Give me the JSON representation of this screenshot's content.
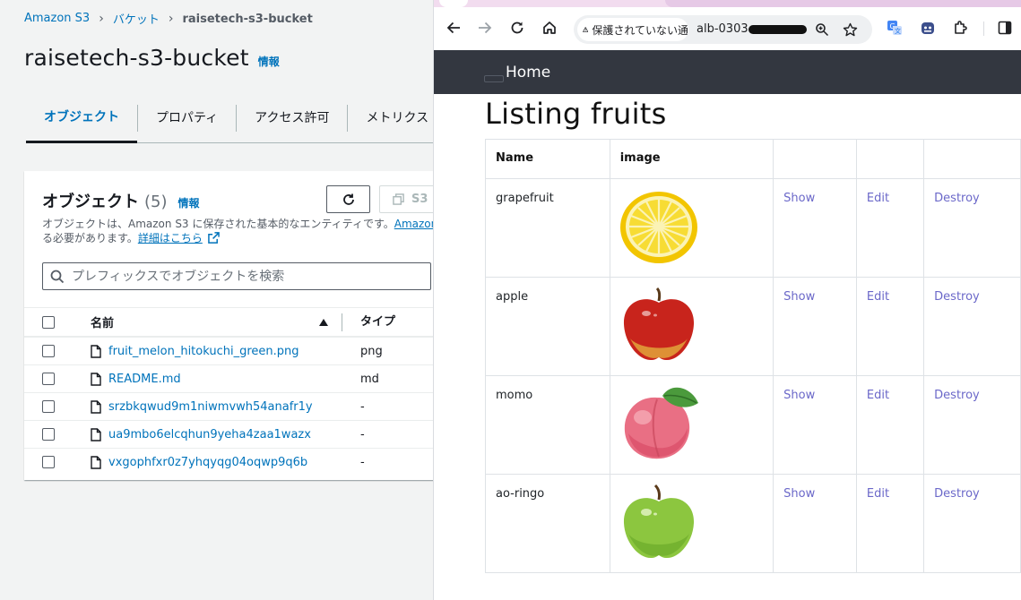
{
  "s3": {
    "breadcrumbs": [
      "Amazon S3",
      "バケット",
      "raisetech-s3-bucket"
    ],
    "title": "raisetech-s3-bucket",
    "info_link": "情報",
    "tabs": [
      "オブジェクト",
      "プロパティ",
      "アクセス許可",
      "メトリクス"
    ],
    "objects_panel": {
      "heading": "オブジェクト",
      "count": "(5)",
      "info_link": "情報",
      "copy_button": "S3",
      "description_line1": "オブジェクトは、Amazon S3 に保存された基本的なエンティティです。",
      "description_link1": "Amazon",
      "description_line2": "る必要があります。",
      "description_link2": "詳細はこちら",
      "search_placeholder": "プレフィックスでオブジェクトを検索",
      "columns": {
        "name": "名前",
        "type": "タイプ"
      },
      "rows": [
        {
          "name": "fruit_melon_hitokuchi_green.png",
          "type": "png"
        },
        {
          "name": "README.md",
          "type": "md"
        },
        {
          "name": "srzbkqwud9m1niwmvwh54anafr1y",
          "type": "-"
        },
        {
          "name": "ua9mbo6elcqhun9yeha4zaa1wazx",
          "type": "-"
        },
        {
          "name": "vxgophfxr0z7yhqyqg04oqwp9q6b",
          "type": "-"
        }
      ]
    }
  },
  "browser": {
    "security_chip": "保護されていない通",
    "url_prefix": "alb-0303-",
    "nav_home": "Home",
    "page_title": "Listing fruits",
    "table": {
      "headers": {
        "name": "Name",
        "image": "image"
      },
      "rows": [
        {
          "name": "grapefruit",
          "image": "grapefruit-image",
          "show": "Show",
          "edit": "Edit",
          "destroy": "Destroy"
        },
        {
          "name": "apple",
          "image": "apple-image",
          "show": "Show",
          "edit": "Edit",
          "destroy": "Destroy"
        },
        {
          "name": "momo",
          "image": "peach-image",
          "show": "Show",
          "edit": "Edit",
          "destroy": "Destroy"
        },
        {
          "name": "ao-ringo",
          "image": "green-apple-image",
          "show": "Show",
          "edit": "Edit",
          "destroy": "Destroy"
        }
      ]
    }
  },
  "colors": {
    "aws_link": "#0073bb",
    "navbar": "#333740",
    "fruit_link": "#6b68c9",
    "tabstrip": "#f2dcef"
  }
}
